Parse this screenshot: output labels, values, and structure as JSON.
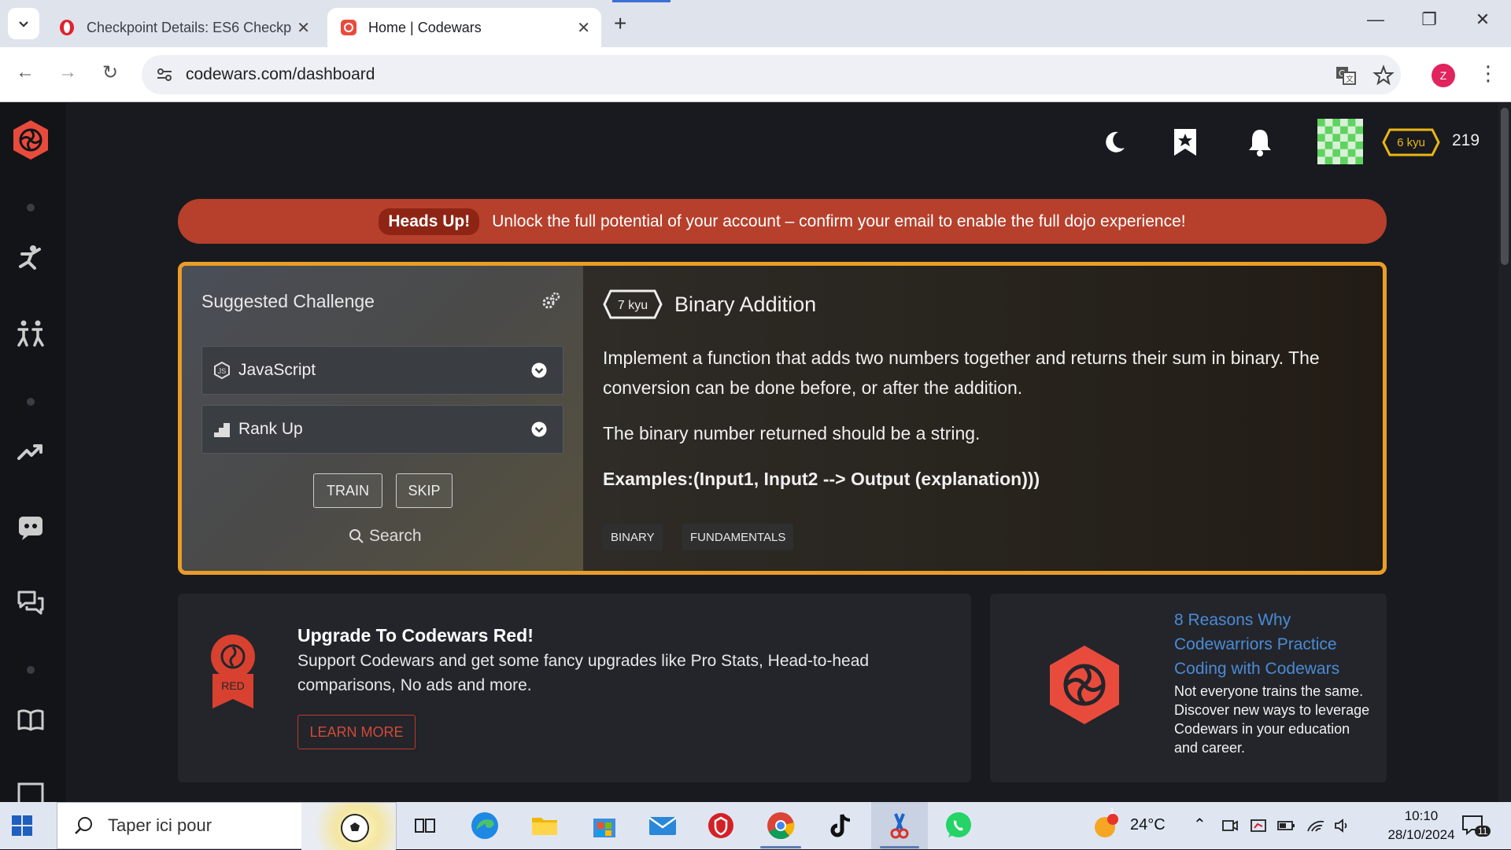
{
  "browser": {
    "tabs": [
      {
        "title": "Checkpoint Details: ES6 Checkp",
        "active": false
      },
      {
        "title": "Home | Codewars",
        "active": true
      }
    ],
    "url": "codewars.com/dashboard",
    "profile_initial": "Z"
  },
  "topbar": {
    "rank": "6 kyu",
    "honor": "219"
  },
  "banner": {
    "label": "Heads Up!",
    "message": "Unlock the full potential of your account – confirm your email to enable the full dojo experience!"
  },
  "suggested": {
    "title": "Suggested Challenge",
    "language": "JavaScript",
    "strategy": "Rank Up",
    "train_label": "TRAIN",
    "skip_label": "SKIP",
    "search_label": "Search"
  },
  "kata": {
    "rank": "7 kyu",
    "name": "Binary Addition",
    "paragraph1": "Implement a function that adds two numbers together and returns their sum in binary. The conversion can be done before, or after the addition.",
    "paragraph2": "The binary number returned should be a string.",
    "examples": "Examples:(Input1, Input2 --> Output (explanation)))",
    "tags": [
      "BINARY",
      "FUNDAMENTALS"
    ]
  },
  "upgrade": {
    "badge_text": "RED",
    "heading": "Upgrade To Codewars Red!",
    "body": "Support Codewars and get some fancy upgrades like Pro Stats, Head-to-head comparisons, No ads and more.",
    "button": "LEARN MORE"
  },
  "article": {
    "link": "8 Reasons Why Codewarriors Practice Coding with Codewars",
    "text": "Not everyone trains the same. Discover new ways to leverage Codewars in your education and career."
  },
  "taskbar": {
    "search_placeholder": "Taper ici pour",
    "weather": "24°C",
    "weather_badge": "1",
    "time": "10:10",
    "date": "28/10/2024",
    "notifications": "11"
  },
  "colors": {
    "accent_red": "#b6402c",
    "border_orange": "#e99d28",
    "link_blue": "#4b8bd4"
  }
}
